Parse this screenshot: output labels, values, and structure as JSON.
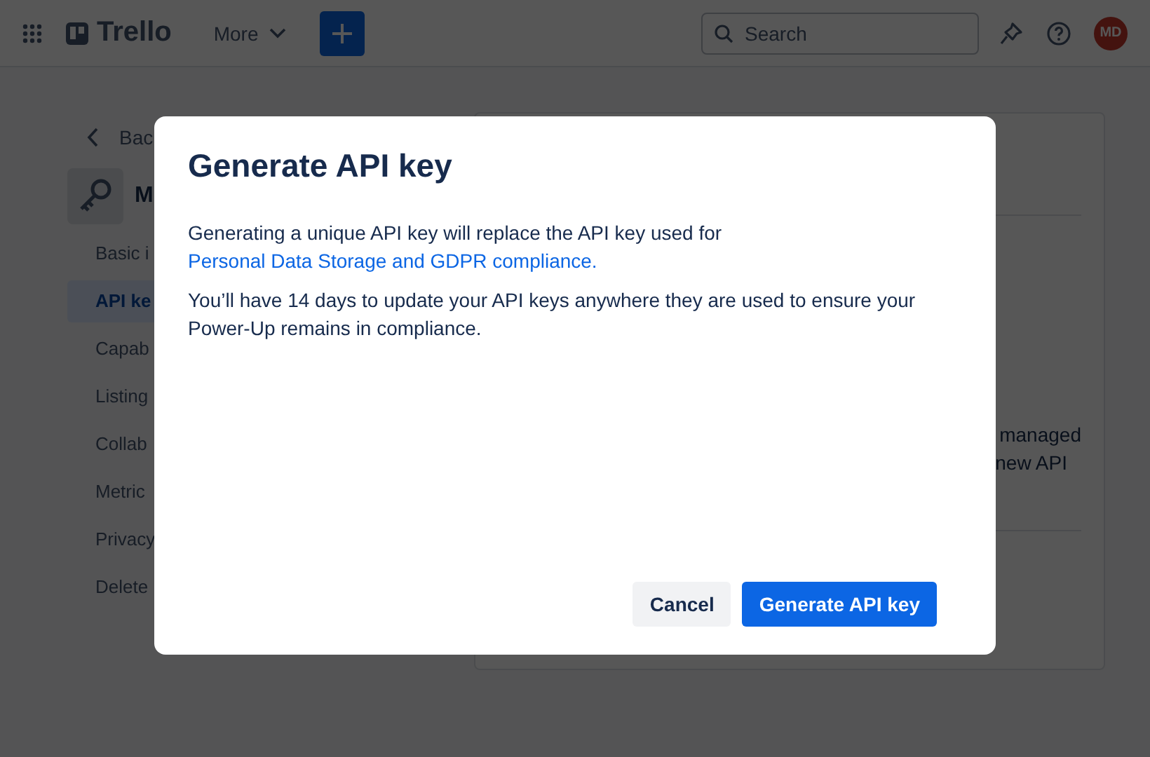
{
  "header": {
    "logo": "Trello",
    "more_menu": "More",
    "search": {
      "placeholder": "Search"
    },
    "avatar": "MD"
  },
  "sidebar": {
    "back": "Bac",
    "title": "M",
    "items": [
      {
        "label": "Basic i",
        "selected": false
      },
      {
        "label": "API ke",
        "selected": true
      },
      {
        "label": "Capab",
        "selected": false
      },
      {
        "label": "Listing",
        "selected": false
      },
      {
        "label": "Collab",
        "selected": false
      },
      {
        "label": "Metric",
        "selected": false
      },
      {
        "label": "Privacy",
        "selected": false
      },
      {
        "label": "Delete",
        "selected": false
      }
    ]
  },
  "panel": {
    "text_lines": [
      "managed",
      "new API"
    ]
  },
  "dialog": {
    "title": "Generate API key",
    "intro": {
      "text": "Generating a unique API key will replace the API key used for ",
      "link": "Personal Data Storage and GDPR compliance."
    },
    "note": "You’ll have 14 days to update your API keys anywhere they are used to ensure your Power-Up remains in compliance.",
    "buttons": [
      {
        "label": "Cancel",
        "kind": "secondary"
      },
      {
        "label": "Generate API key",
        "kind": "primary"
      }
    ]
  }
}
